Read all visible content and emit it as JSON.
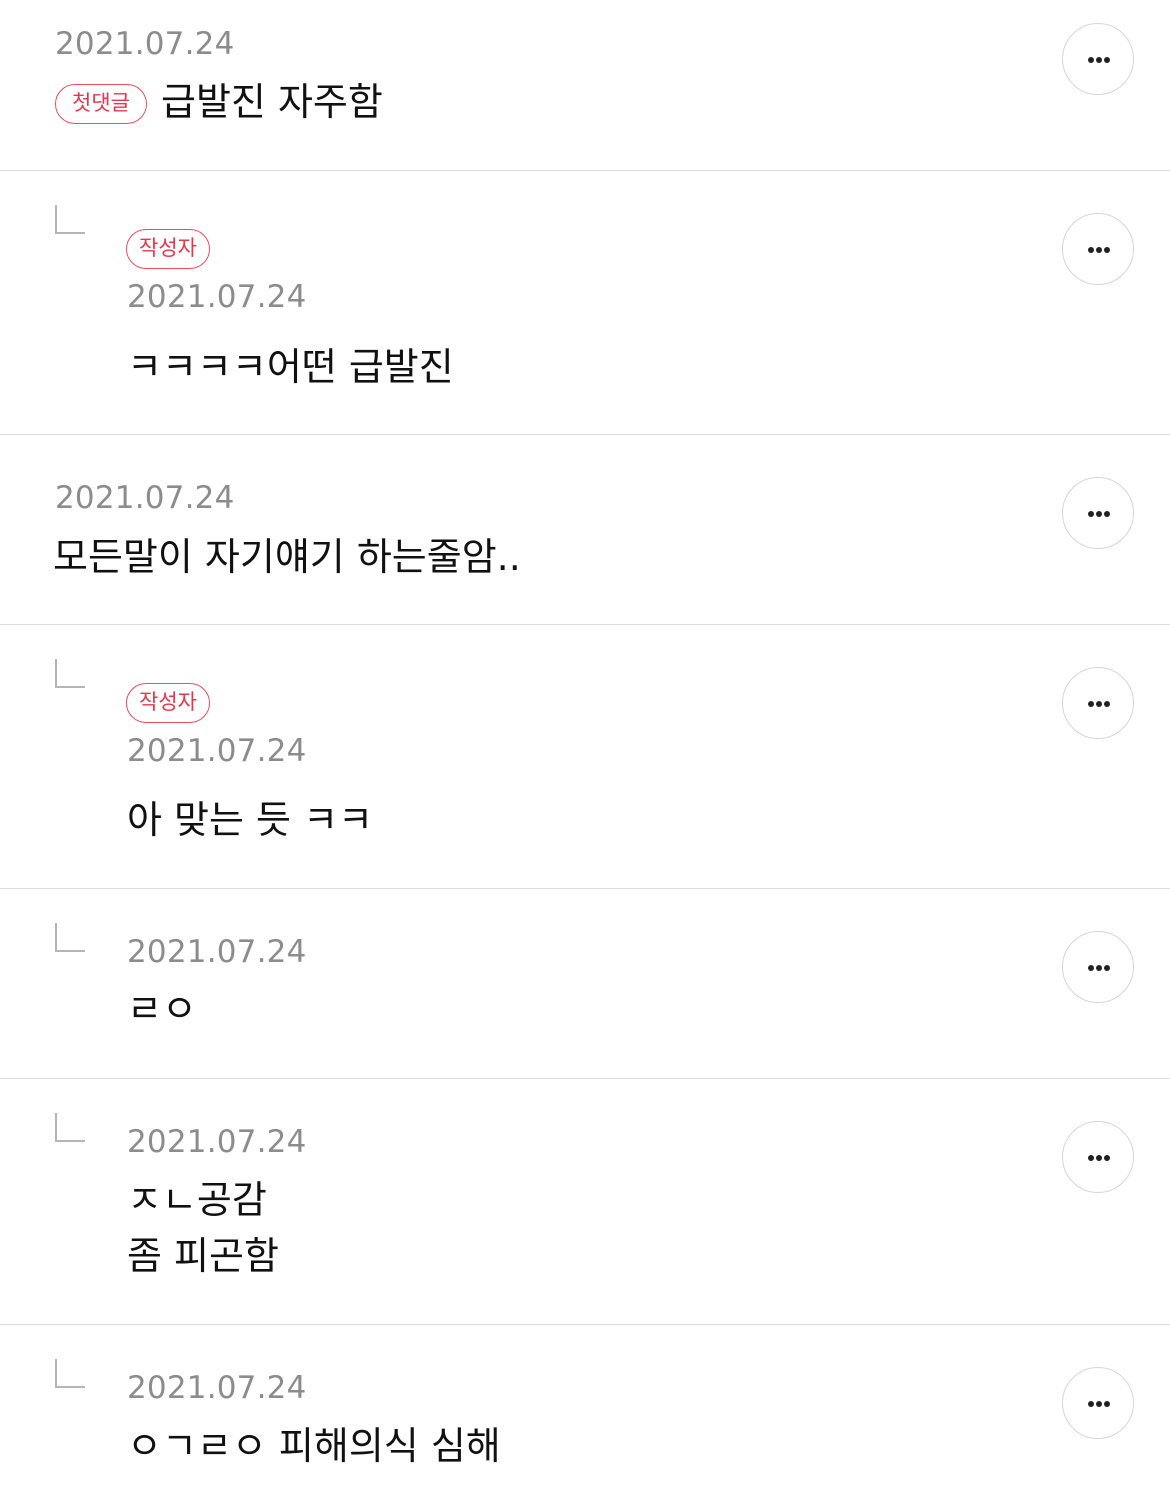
{
  "comments": [
    {
      "date": "2021.07.24",
      "badge": "첫댓글",
      "text": "급발진 자주함"
    },
    {
      "date": "2021.07.24",
      "badge": "작성자",
      "text": "ㅋㅋㅋㅋ어떤 급발진"
    },
    {
      "date": "2021.07.24",
      "text": "모든말이 자기얘기 하는줄암.."
    },
    {
      "date": "2021.07.24",
      "badge": "작성자",
      "text": "아 맞는 듯 ㅋㅋ"
    },
    {
      "date": "2021.07.24",
      "text": "ㄹㅇ"
    },
    {
      "date": "2021.07.24",
      "text_line1": "ㅈㄴ공감",
      "text_line2": "좀 피곤함"
    },
    {
      "date": "2021.07.24",
      "text": "ㅇㄱㄹㅇ 피해의식 심해"
    }
  ],
  "icons": {
    "reply": "reply-arrow-icon",
    "more": "more-dots-icon"
  },
  "colors": {
    "badge": "#e8364a",
    "date": "#8c8c8c",
    "divider": "#dddddd"
  }
}
